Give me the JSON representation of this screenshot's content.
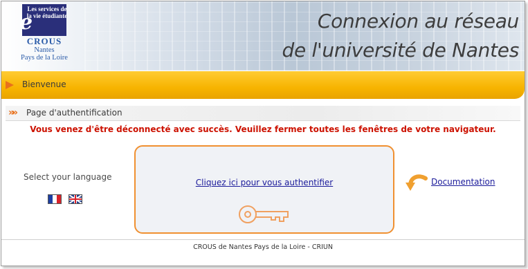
{
  "logo": {
    "tagline": "Les services de la vie étudiante",
    "letter": "e",
    "name": "CROUS",
    "city": "Nantes",
    "region": "Pays de la Loire"
  },
  "header": {
    "title_line1": "Connexion au réseau",
    "title_line2": "de l'université de Nantes"
  },
  "nav": {
    "welcome_label": "Bienvenue",
    "section_label": "Page d'authentification"
  },
  "message": "Vous venez d'être déconnecté avec succès. Veuillez fermer toutes les fenêtres de votre navigateur.",
  "language": {
    "label": "Select your language",
    "flags": [
      "flag-fr-icon",
      "flag-uk-icon"
    ]
  },
  "auth": {
    "link_label": "Cliquez ici pour vous authentifier",
    "icon": "key-icon"
  },
  "documentation": {
    "link_label": "Documentation",
    "icon": "curved-arrow-icon"
  },
  "footer": "CROUS de Nantes Pays de la Loire - CRIUN",
  "colors": {
    "accent_orange": "#f09030",
    "bar_yellow": "#f7b400",
    "message_red": "#cc1100",
    "link_blue": "#1a1a9a",
    "brand_navy": "#2a2f7a"
  }
}
